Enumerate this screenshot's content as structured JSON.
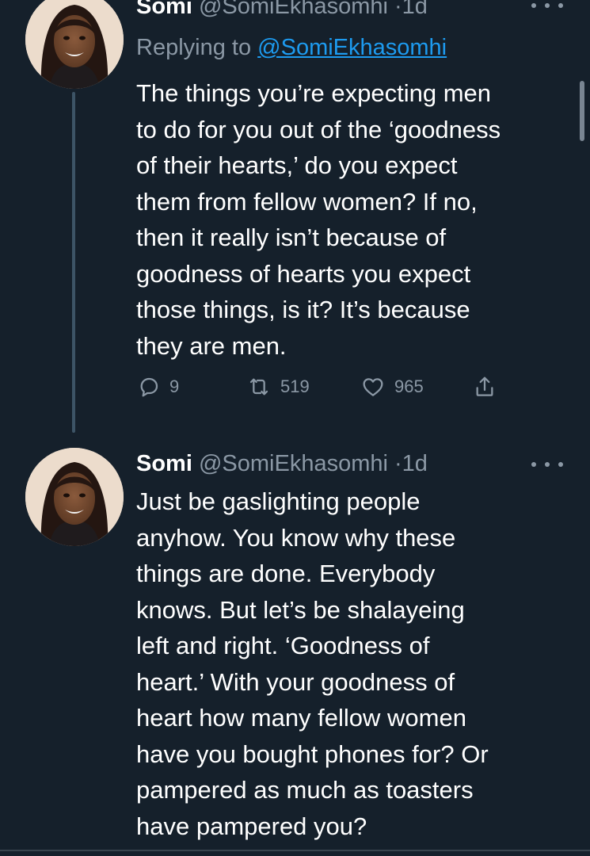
{
  "tweets": [
    {
      "author": {
        "name": "Somi",
        "handle": "@SomiEkhasomhi"
      },
      "separator": "·",
      "time": "1d",
      "reply_prefix": "Replying to ",
      "reply_to": "@SomiEkhasomhi",
      "text": "The things you’re expecting men\nto do for you out of the ‘goodness\nof their hearts,’ do you expect\nthem from fellow women? If no,\nthen it really isn’t because of\ngoodness of hearts you expect\nthose things, is it? It’s because\nthey are men.",
      "stats": {
        "replies": "9",
        "retweets": "519",
        "likes": "965"
      }
    },
    {
      "author": {
        "name": "Somi",
        "handle": "@SomiEkhasomhi"
      },
      "separator": "·",
      "time": "1d",
      "text": "Just be gaslighting people\nanyhow. You know why these\nthings are done. Everybody\nknows. But let’s be shalayeing\nleft and right. ‘Goodness of\nheart.’ With your goodness of\nheart how many fellow women\nhave you bought phones for? Or\npampered as much as toasters\nhave pampered you?"
    }
  ],
  "colors": {
    "background": "#15202b",
    "text_primary": "#ffffff",
    "text_secondary": "#8b98a5",
    "link": "#1d9bf0",
    "thread_line": "#3d5466"
  },
  "icons": {
    "reply": "reply-icon",
    "retweet": "retweet-icon",
    "like": "heart-icon",
    "share": "share-icon",
    "more": "more-options-icon"
  }
}
